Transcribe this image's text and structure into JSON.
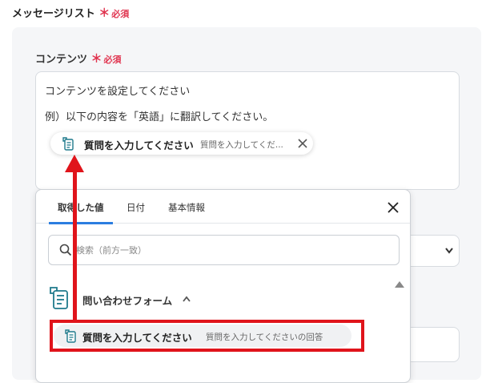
{
  "section": {
    "title": "メッセージリスト",
    "required": "必須"
  },
  "content_field": {
    "label": "コンテンツ",
    "required": "必須",
    "line1": "コンテンツを設定してください",
    "line2": "例）以下の内容を「英語」に翻訳してください。",
    "chip": {
      "label": "質問を入力してください",
      "sub": "質問を入力してくだ..."
    }
  },
  "popup": {
    "tabs": [
      "取得した値",
      "日付",
      "基本情報"
    ],
    "active_tab": "取得した値",
    "search_placeholder": "検索（前方一致）",
    "group_label": "問い合わせフォーム",
    "item": {
      "label": "質問を入力してください",
      "sub": "質問を入力してくださいの回答"
    }
  },
  "colors": {
    "required": "#e0344f",
    "highlight": "#e0141b",
    "tab_active": "#2b7de0",
    "icon": "#1f7a8c"
  }
}
